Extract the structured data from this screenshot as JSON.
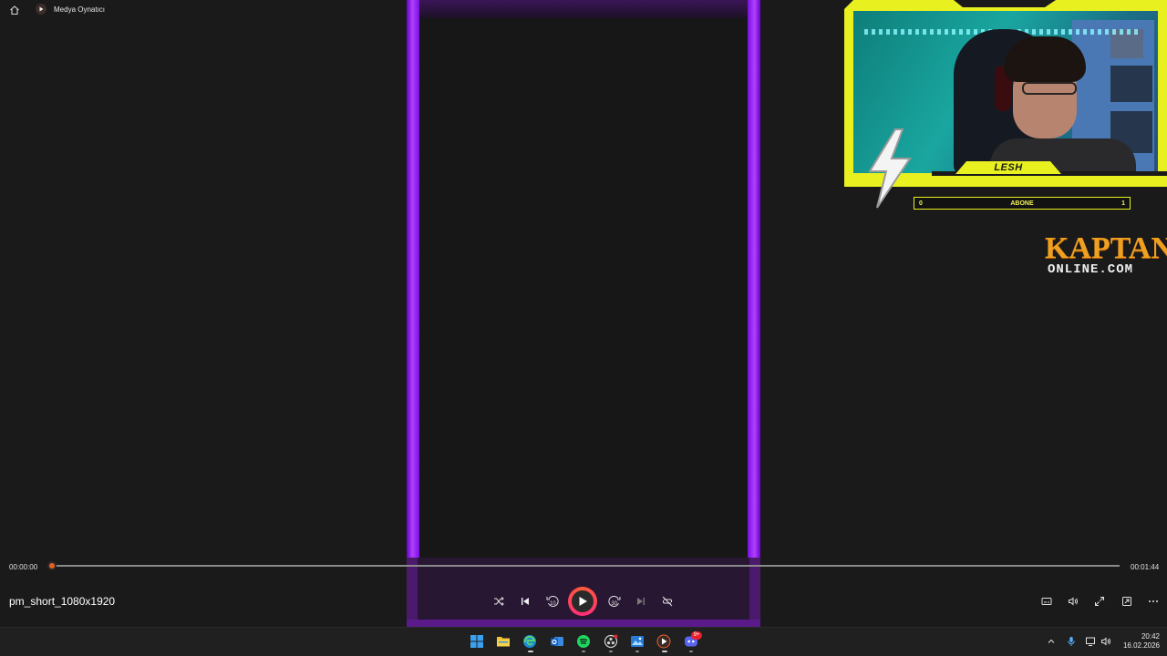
{
  "window": {
    "title": "Medya Oynatıcı",
    "icons": {
      "home": "home-icon",
      "app": "media-player-icon"
    }
  },
  "overlay": {
    "streamer_name": "LESH",
    "subscriber_goal": {
      "label": "ABONE",
      "current": "0",
      "target": "1"
    },
    "brand": {
      "main": "KAPTAN",
      "sub": "ONLINE.COM"
    },
    "colors": {
      "frame_purple": "#8a10e8",
      "cam_yellow": "#e8f020",
      "brand_orange": "#f0a020"
    }
  },
  "player": {
    "current_time": "00:00:00",
    "total_time": "00:01:44",
    "progress": 0,
    "filename": "pm_short_1080x1920",
    "accent_color": "#e86020",
    "controls": [
      {
        "name": "shuffle-button",
        "icon": "shuffle-icon"
      },
      {
        "name": "previous-button",
        "icon": "previous-icon"
      },
      {
        "name": "rewind-10-button",
        "icon": "rewind-10-icon"
      },
      {
        "name": "play-button",
        "icon": "play-icon"
      },
      {
        "name": "forward-30-button",
        "icon": "forward-30-icon"
      },
      {
        "name": "next-button",
        "icon": "next-icon"
      },
      {
        "name": "repeat-button",
        "icon": "repeat-off-icon"
      }
    ],
    "right_controls": [
      {
        "name": "subtitles-button",
        "icon": "subtitles-icon"
      },
      {
        "name": "volume-button",
        "icon": "volume-icon"
      },
      {
        "name": "fullscreen-button",
        "icon": "fullscreen-icon"
      },
      {
        "name": "mini-player-button",
        "icon": "mini-player-icon"
      },
      {
        "name": "more-options-button",
        "icon": "more-icon"
      }
    ],
    "rewind_label": "10",
    "forward_label": "30"
  },
  "taskbar": {
    "apps": [
      "start-icon",
      "file-explorer-icon",
      "edge-icon",
      "outlook-icon",
      "spotify-icon",
      "obs-icon",
      "photos-icon",
      "media-player-icon",
      "discord-icon"
    ],
    "discord_badge": "9+",
    "clock": {
      "time": "20:42",
      "date": "16.02.2026"
    }
  }
}
